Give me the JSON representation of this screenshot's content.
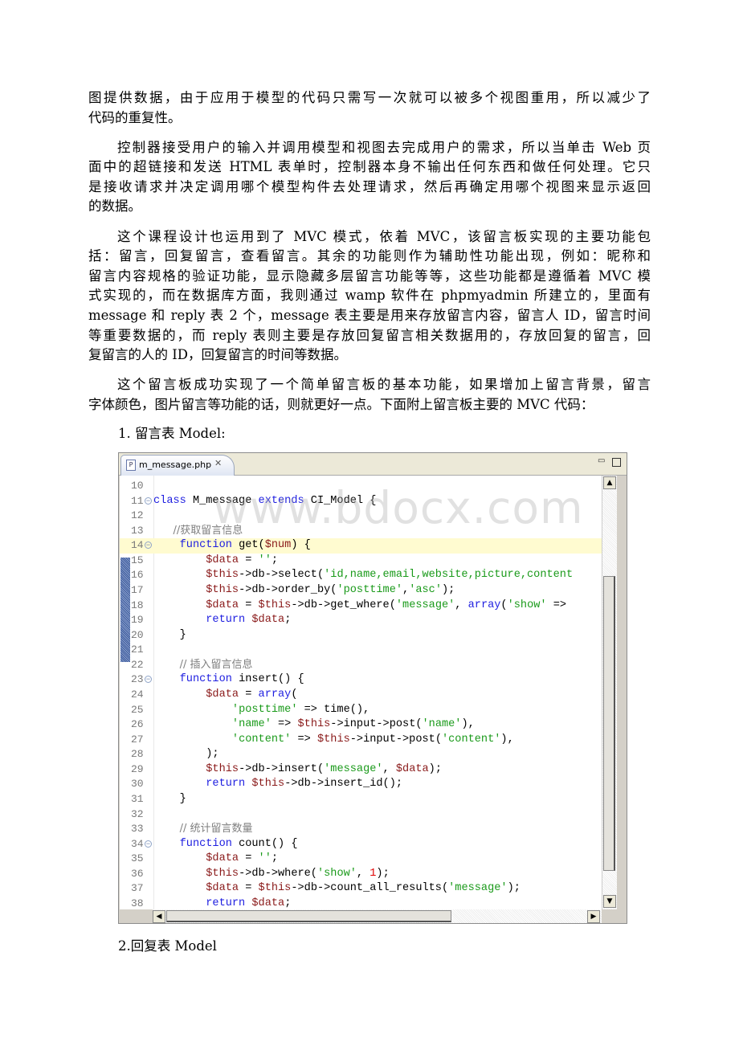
{
  "paragraphs": [
    {
      "indent": false,
      "lines": [
        "图提供数据，由于应用于模型的代码只需写一次就可以被多个视图重用，所以减少了",
        "代码的重复性。"
      ]
    },
    {
      "indent": true,
      "lines": [
        "控制器接受用户的输入并调用模型和视图去完成用户的需求，所以当单击 Web 页",
        "面中的超链接和发送 HTML 表单时，控制器本身不输出任何东西和做任何处理。它只",
        "是接收请求并决定调用哪个模型构件去处理请求，然后再确定用哪个视图来显示返回",
        "的数据。"
      ]
    },
    {
      "indent": true,
      "lines": [
        "这个课程设计也运用到了 MVC 模式，依着 MVC，该留言板实现的主要功能包",
        "括：留言，回复留言，查看留言。其余的功能则作为辅助性功能出现，例如：昵称和",
        "留言内容规格的验证功能，显示隐藏多层留言功能等等，这些功能都是遵循着 MVC 模",
        "式实现的，而在数据库方面，我则通过 wamp 软件在 phpmyadmin 所建立的，里面有",
        "message 和 reply 表 2 个，message 表主要是用来存放留言内容，留言人 ID，留言时间",
        "等重要数据的，而 reply 表则主要是存放回复留言相关数据用的，存放回复的留言，回",
        "复留言的人的 ID，回复留言的时间等数据。"
      ]
    },
    {
      "indent": true,
      "lines": [
        "这个留言板成功实现了一个简单留言板的基本功能，如果增加上留言背景，留言",
        "字体颜色，图片留言等功能的话，则就更好一点。下面附上留言板主要的 MVC 代码："
      ]
    }
  ],
  "heading1": "1. 留言表 Model:",
  "heading2": "2.回复表 Model",
  "watermark": "www.bdocx.com",
  "editor": {
    "tab_label": "m_message.php",
    "file_icon": "P",
    "highlighted_line": 14,
    "colors": {
      "keyword": "#1e1ee0",
      "variable": "#8a1a1a",
      "string": "#1a9a1a",
      "number": "#e00000",
      "comment": "#808080",
      "current_line": "#fffbd0"
    },
    "lines": [
      {
        "n": "10",
        "t": []
      },
      {
        "n": "11",
        "fold": true,
        "t": [
          [
            "kw",
            "class"
          ],
          [
            "pl",
            " M_message "
          ],
          [
            "kw",
            "extends"
          ],
          [
            "pl",
            " CI_Model {"
          ]
        ]
      },
      {
        "n": "12",
        "t": []
      },
      {
        "n": "13",
        "t": [
          [
            "pl",
            "   "
          ],
          [
            "cm",
            "//获取留言信息"
          ]
        ]
      },
      {
        "n": "14",
        "fold": true,
        "t": [
          [
            "pl",
            "    "
          ],
          [
            "kw",
            "function"
          ],
          [
            "pl",
            " get("
          ],
          [
            "var",
            "$num"
          ],
          [
            "pl",
            ") {"
          ]
        ]
      },
      {
        "n": "15",
        "t": [
          [
            "pl",
            "        "
          ],
          [
            "var",
            "$data"
          ],
          [
            "pl",
            " = "
          ],
          [
            "str",
            "''"
          ],
          [
            "pl",
            ";"
          ]
        ]
      },
      {
        "n": "16",
        "t": [
          [
            "pl",
            "        "
          ],
          [
            "var",
            "$this"
          ],
          [
            "pl",
            "->db->select("
          ],
          [
            "str",
            "'id,name,email,website,picture,content"
          ]
        ]
      },
      {
        "n": "17",
        "t": [
          [
            "pl",
            "        "
          ],
          [
            "var",
            "$this"
          ],
          [
            "pl",
            "->db->order_by("
          ],
          [
            "str",
            "'posttime'"
          ],
          [
            "pl",
            ","
          ],
          [
            "str",
            "'asc'"
          ],
          [
            "pl",
            ");"
          ]
        ]
      },
      {
        "n": "18",
        "t": [
          [
            "pl",
            "        "
          ],
          [
            "var",
            "$data"
          ],
          [
            "pl",
            " = "
          ],
          [
            "var",
            "$this"
          ],
          [
            "pl",
            "->db->get_where("
          ],
          [
            "str",
            "'message'"
          ],
          [
            "pl",
            ", "
          ],
          [
            "kw",
            "array"
          ],
          [
            "pl",
            "("
          ],
          [
            "str",
            "'show'"
          ],
          [
            "pl",
            " =>"
          ]
        ]
      },
      {
        "n": "19",
        "t": [
          [
            "pl",
            "        "
          ],
          [
            "kw",
            "return"
          ],
          [
            "pl",
            " "
          ],
          [
            "var",
            "$data"
          ],
          [
            "pl",
            ";"
          ]
        ]
      },
      {
        "n": "20",
        "t": [
          [
            "pl",
            "    }"
          ]
        ]
      },
      {
        "n": "21",
        "t": []
      },
      {
        "n": "22",
        "t": [
          [
            "pl",
            "    "
          ],
          [
            "cm",
            "// 插入留言信息"
          ]
        ]
      },
      {
        "n": "23",
        "fold": true,
        "t": [
          [
            "pl",
            "    "
          ],
          [
            "kw",
            "function"
          ],
          [
            "pl",
            " insert() {"
          ]
        ]
      },
      {
        "n": "24",
        "t": [
          [
            "pl",
            "        "
          ],
          [
            "var",
            "$data"
          ],
          [
            "pl",
            " = "
          ],
          [
            "kw",
            "array"
          ],
          [
            "pl",
            "("
          ]
        ]
      },
      {
        "n": "25",
        "t": [
          [
            "pl",
            "            "
          ],
          [
            "str",
            "'posttime'"
          ],
          [
            "pl",
            " => time(),"
          ]
        ]
      },
      {
        "n": "26",
        "t": [
          [
            "pl",
            "            "
          ],
          [
            "str",
            "'name'"
          ],
          [
            "pl",
            " => "
          ],
          [
            "var",
            "$this"
          ],
          [
            "pl",
            "->input->post("
          ],
          [
            "str",
            "'name'"
          ],
          [
            "pl",
            "),"
          ]
        ]
      },
      {
        "n": "27",
        "t": [
          [
            "pl",
            "            "
          ],
          [
            "str",
            "'content'"
          ],
          [
            "pl",
            " => "
          ],
          [
            "var",
            "$this"
          ],
          [
            "pl",
            "->input->post("
          ],
          [
            "str",
            "'content'"
          ],
          [
            "pl",
            "),"
          ]
        ]
      },
      {
        "n": "28",
        "t": [
          [
            "pl",
            "        );"
          ]
        ]
      },
      {
        "n": "29",
        "t": [
          [
            "pl",
            "        "
          ],
          [
            "var",
            "$this"
          ],
          [
            "pl",
            "->db->insert("
          ],
          [
            "str",
            "'message'"
          ],
          [
            "pl",
            ", "
          ],
          [
            "var",
            "$data"
          ],
          [
            "pl",
            ");"
          ]
        ]
      },
      {
        "n": "30",
        "t": [
          [
            "pl",
            "        "
          ],
          [
            "kw",
            "return"
          ],
          [
            "pl",
            " "
          ],
          [
            "var",
            "$this"
          ],
          [
            "pl",
            "->db->insert_id();"
          ]
        ]
      },
      {
        "n": "31",
        "t": [
          [
            "pl",
            "    }"
          ]
        ]
      },
      {
        "n": "32",
        "t": []
      },
      {
        "n": "33",
        "t": [
          [
            "pl",
            "    "
          ],
          [
            "cm",
            "// 统计留言数量"
          ]
        ]
      },
      {
        "n": "34",
        "fold": true,
        "t": [
          [
            "pl",
            "    "
          ],
          [
            "kw",
            "function"
          ],
          [
            "pl",
            " count() {"
          ]
        ]
      },
      {
        "n": "35",
        "t": [
          [
            "pl",
            "        "
          ],
          [
            "var",
            "$data"
          ],
          [
            "pl",
            " = "
          ],
          [
            "str",
            "''"
          ],
          [
            "pl",
            ";"
          ]
        ]
      },
      {
        "n": "36",
        "t": [
          [
            "pl",
            "        "
          ],
          [
            "var",
            "$this"
          ],
          [
            "pl",
            "->db->where("
          ],
          [
            "str",
            "'show'"
          ],
          [
            "pl",
            ", "
          ],
          [
            "num",
            "1"
          ],
          [
            "pl",
            ");"
          ]
        ]
      },
      {
        "n": "37",
        "t": [
          [
            "pl",
            "        "
          ],
          [
            "var",
            "$data"
          ],
          [
            "pl",
            " = "
          ],
          [
            "var",
            "$this"
          ],
          [
            "pl",
            "->db->count_all_results("
          ],
          [
            "str",
            "'message'"
          ],
          [
            "pl",
            ");"
          ]
        ]
      },
      {
        "n": "38",
        "t": [
          [
            "pl",
            "        "
          ],
          [
            "kw",
            "return"
          ],
          [
            "pl",
            " "
          ],
          [
            "var",
            "$data"
          ],
          [
            "pl",
            ";"
          ]
        ]
      }
    ]
  }
}
